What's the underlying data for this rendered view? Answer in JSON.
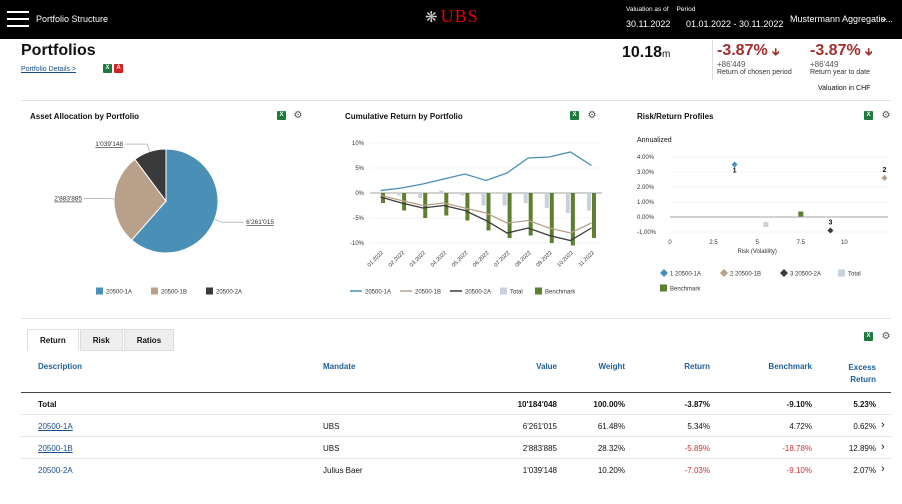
{
  "topbar": {
    "title": "Portfolio Structure",
    "logo": "UBS",
    "valuation_label": "Valuation as of",
    "period_label": "Period",
    "valuation_date": "30.11.2022",
    "period": "01.01.2022 - 30.11.2022",
    "client": "Mustermann Aggregatio..."
  },
  "header": {
    "title": "Portfolios",
    "details_link": "Portfolio Details >",
    "total_value": "10.18",
    "total_unit": "m",
    "kpi1": {
      "pct": "-3.87%",
      "abs": "+86'449",
      "caption": "Return of chosen period"
    },
    "kpi2": {
      "pct": "-3.87%",
      "abs": "+86'449",
      "caption": "Return year to date"
    },
    "valuation_currency": "Valuation in CHF"
  },
  "panels": {
    "allocation_title": "Asset Allocation by Portfolio",
    "cumulative_title": "Cumulative Return by Portfolio",
    "risk_title": "Risk/Return Profiles",
    "risk_subtitle": "Annualized"
  },
  "colors": {
    "p1": "#4a8fb5",
    "p2": "#b8a08a",
    "p3": "#3a3a3a",
    "total": "#c8d2dc",
    "benchmark": "#5d7f2e",
    "negative": "#a0302f"
  },
  "chart_data": [
    {
      "type": "pie",
      "title": "Asset Allocation by Portfolio",
      "labels": [
        "20500-1A",
        "20500-1B",
        "20500-2A"
      ],
      "values": [
        6261015,
        2883885,
        1039148
      ],
      "value_labels": [
        "6'261'015",
        "2'883'885",
        "1'039'148"
      ]
    },
    {
      "type": "line",
      "title": "Cumulative Return by Portfolio",
      "categories": [
        "01.2022",
        "02.2022",
        "03.2022",
        "04.2022",
        "05.2022",
        "06.2022",
        "07.2022",
        "08.2022",
        "09.2022",
        "10.2022",
        "11.2022"
      ],
      "yticks": [
        "10%",
        "5%",
        "0%",
        "-5%",
        "-10%"
      ],
      "ylim": [
        -10,
        10
      ],
      "series": [
        {
          "name": "20500-1A",
          "kind": "line",
          "values": [
            0.5,
            1.0,
            1.8,
            2.8,
            3.8,
            2.5,
            4.0,
            7.0,
            7.2,
            8.2,
            5.5
          ]
        },
        {
          "name": "20500-1B",
          "kind": "line",
          "values": [
            -0.5,
            -1.5,
            -2.5,
            -2.0,
            -3.0,
            -4.0,
            -6.0,
            -5.5,
            -7.0,
            -8.0,
            -6.0
          ]
        },
        {
          "name": "20500-2A",
          "kind": "line",
          "values": [
            -0.8,
            -2.0,
            -3.0,
            -2.5,
            -3.5,
            -5.5,
            -8.0,
            -7.0,
            -8.5,
            -9.5,
            -7.0
          ]
        },
        {
          "name": "Total",
          "kind": "bar",
          "values": [
            0.2,
            -0.5,
            -1.0,
            0.5,
            -0.5,
            -2.5,
            -2.5,
            -2.0,
            -3.0,
            -4.0,
            -3.5
          ]
        },
        {
          "name": "Benchmark",
          "kind": "bar",
          "values": [
            -2.0,
            -3.5,
            -5.0,
            -4.5,
            -5.5,
            -7.5,
            -9.0,
            -8.5,
            -10.0,
            -10.5,
            -9.0
          ]
        }
      ]
    },
    {
      "type": "scatter",
      "title": "Risk/Return Profiles",
      "xlabel": "Risk (Volatility)",
      "xticks": [
        "0",
        "2.5",
        "5",
        "7.5",
        "10"
      ],
      "yticks": [
        "4.00%",
        "3.00%",
        "2.00%",
        "1.00%",
        "0.00%",
        "-1.00%"
      ],
      "xlim": [
        0,
        12.5
      ],
      "ylim": [
        -1.0,
        4.0
      ],
      "points": [
        {
          "label": "1",
          "name": "20500-1A",
          "x": 3.7,
          "y": 3.5
        },
        {
          "label": "2",
          "name": "20500-1B",
          "x": 12.3,
          "y": 2.6
        },
        {
          "label": "3",
          "name": "20500-2A",
          "x": 9.2,
          "y": -0.9
        },
        {
          "label": "",
          "name": "Total",
          "x": 5.5,
          "y": -0.5
        },
        {
          "label": "",
          "name": "Benchmark",
          "x": 7.5,
          "y": 0.2
        }
      ],
      "legend": [
        "1 20500-1A",
        "2 20500-1B",
        "3 20500-2A",
        "Total",
        "Benchmark"
      ]
    }
  ],
  "table": {
    "tabs": [
      "Return",
      "Risk",
      "Ratios"
    ],
    "headers": {
      "description": "Description",
      "mandate": "Mandate",
      "value": "Value",
      "weight": "Weight",
      "return": "Return",
      "benchmark": "Benchmark",
      "excess1": "Excess",
      "excess2": "Return"
    },
    "total": {
      "description": "Total",
      "mandate": "",
      "value": "10'184'048",
      "weight": "100.00%",
      "return": "-3.87%",
      "benchmark": "-9.10%",
      "excess": "5.23%"
    },
    "rows": [
      {
        "description": "20500-1A",
        "mandate": "UBS",
        "value": "6'261'015",
        "weight": "61.48%",
        "return": "5.34%",
        "benchmark": "4.72%",
        "excess": "0.62%"
      },
      {
        "description": "20500-1B",
        "mandate": "UBS",
        "value": "2'883'885",
        "weight": "28.32%",
        "return": "-5.89%",
        "benchmark": "-18.78%",
        "excess": "12.89%"
      },
      {
        "description": "20500-2A",
        "mandate": "Julius Baer",
        "value": "1'039'148",
        "weight": "10.20%",
        "return": "-7.03%",
        "benchmark": "-9.10%",
        "excess": "2.07%"
      }
    ]
  }
}
